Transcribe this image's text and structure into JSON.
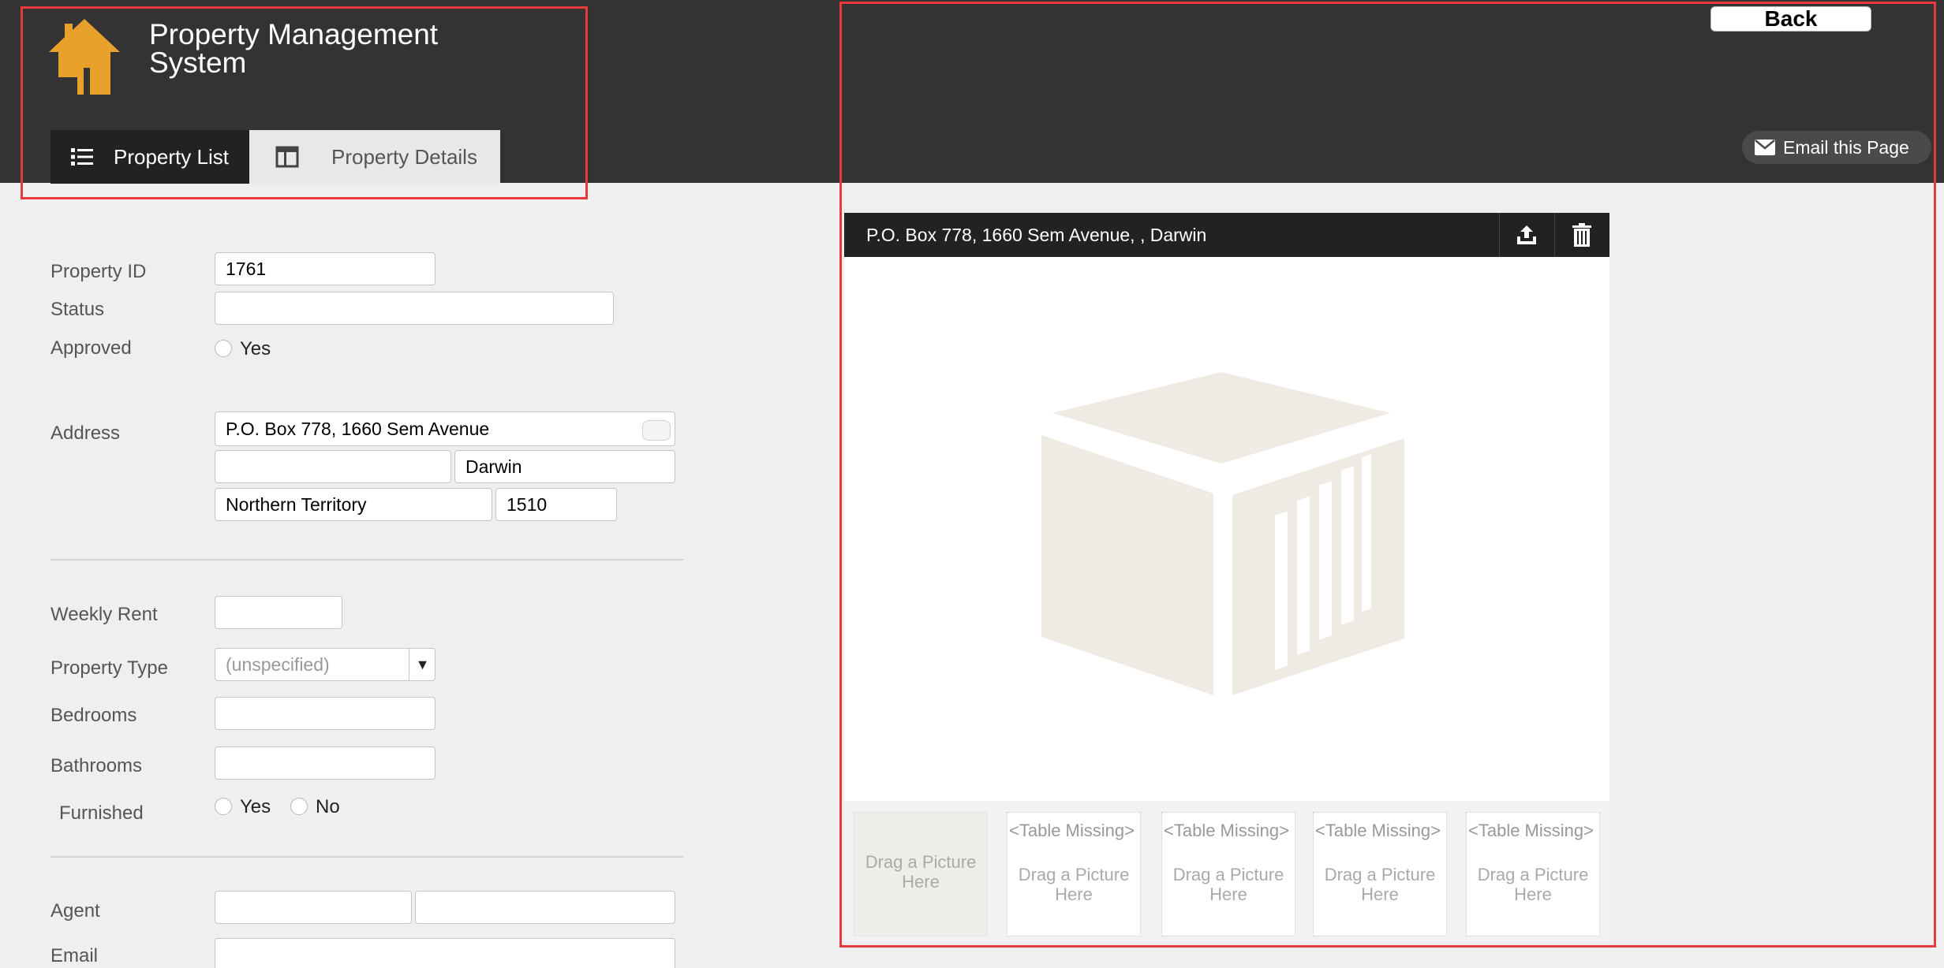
{
  "header": {
    "app_title": "Property Management System",
    "tabs": [
      {
        "label": "Property List",
        "icon": "list-icon",
        "active": true
      },
      {
        "label": "Property Details",
        "icon": "layout-icon",
        "active": false
      }
    ],
    "back_label": "Back",
    "email_label": "Email this Page",
    "colors": {
      "bar": "#333333",
      "logo": "#e8a22b",
      "annotation": "#e8393d"
    }
  },
  "form": {
    "property_id_label": "Property ID",
    "property_id_value": "1761",
    "status_label": "Status",
    "status_value": "",
    "approved_label": "Approved",
    "approved_option": "Yes",
    "address_label": "Address",
    "address_line1": "P.O. Box 778, 1660 Sem Avenue",
    "address_line2": "",
    "city": "Darwin",
    "state": "Northern Territory",
    "postcode": "1510",
    "weekly_rent_label": "Weekly Rent",
    "weekly_rent_value": "",
    "property_type_label": "Property Type",
    "property_type_value": "(unspecified)",
    "bedrooms_label": "Bedrooms",
    "bedrooms_value": "",
    "bathrooms_label": "Bathrooms",
    "bathrooms_value": "",
    "furnished_label": "Furnished",
    "furnished_yes": "Yes",
    "furnished_no": "No",
    "agent_label": "Agent",
    "agent_first": "",
    "agent_last": "",
    "email_label": "Email",
    "email_value": ""
  },
  "card": {
    "title": "P.O. Box 778, 1660 Sem Avenue, , Darwin",
    "icons": [
      "upload-icon",
      "trash-icon",
      "box-placeholder-icon"
    ],
    "drag_text": "Drag a Picture Here",
    "missing_text": "<Table Missing>",
    "thumbs": [
      {
        "missing": "",
        "drag": "Drag a Picture Here"
      },
      {
        "missing": "<Table Missing>",
        "drag": "Drag a Picture Here"
      },
      {
        "missing": "<Table Missing>",
        "drag": "Drag a Picture Here"
      },
      {
        "missing": "<Table Missing>",
        "drag": "Drag a Picture Here"
      },
      {
        "missing": "<Table Missing>",
        "drag": "Drag a Picture Here"
      }
    ]
  }
}
